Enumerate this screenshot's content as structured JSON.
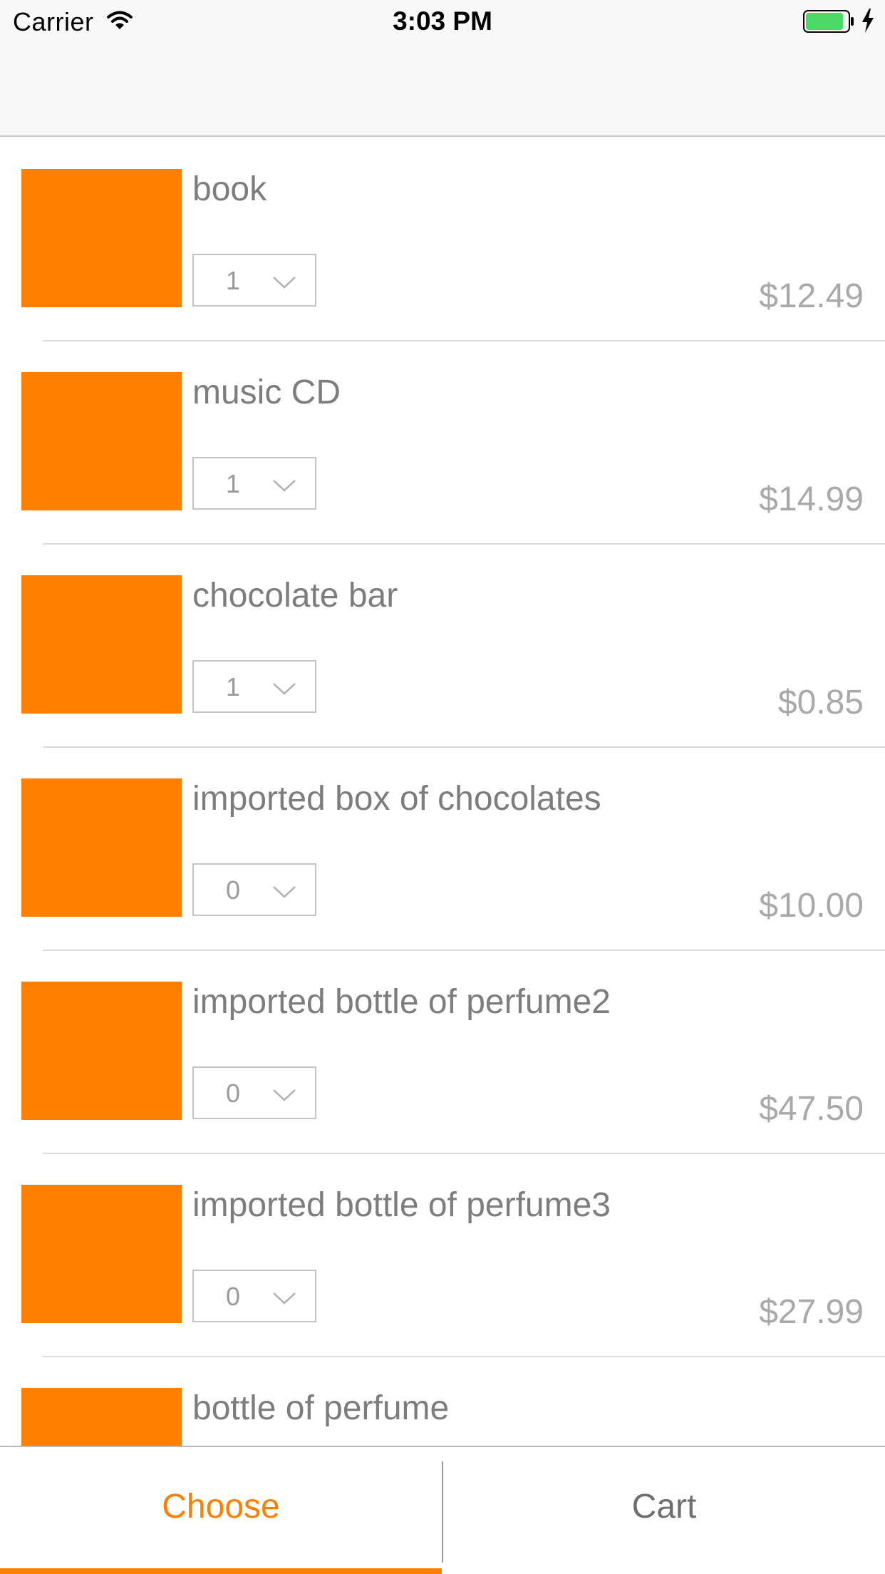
{
  "status_bar": {
    "carrier": "Carrier",
    "time": "3:03 PM",
    "wifi_icon": "wifi-icon",
    "battery_icon": "battery-icon",
    "charging_icon": "charging-bolt-icon",
    "battery_level": 0.9
  },
  "colors": {
    "accent": "#ff8000",
    "product_image": "#ff8000",
    "battery_fill": "#4cd964",
    "text_primary": "#7d7d7d",
    "text_price": "#a9a9a9"
  },
  "products": [
    {
      "name": "book",
      "quantity": "1",
      "price": "$12.49"
    },
    {
      "name": "music CD",
      "quantity": "1",
      "price": "$14.99"
    },
    {
      "name": "chocolate bar",
      "quantity": "1",
      "price": "$0.85"
    },
    {
      "name": "imported box of chocolates",
      "quantity": "0",
      "price": "$10.00"
    },
    {
      "name": "imported bottle of perfume2",
      "quantity": "0",
      "price": "$47.50"
    },
    {
      "name": "imported bottle of perfume3",
      "quantity": "0",
      "price": "$27.99"
    },
    {
      "name": "bottle of perfume",
      "quantity": "",
      "price": ""
    }
  ],
  "quantity_dropdown_icon": "chevron-down-icon",
  "tabbar": {
    "tabs": [
      {
        "label": "Choose",
        "selected": true
      },
      {
        "label": "Cart",
        "selected": false
      }
    ]
  }
}
